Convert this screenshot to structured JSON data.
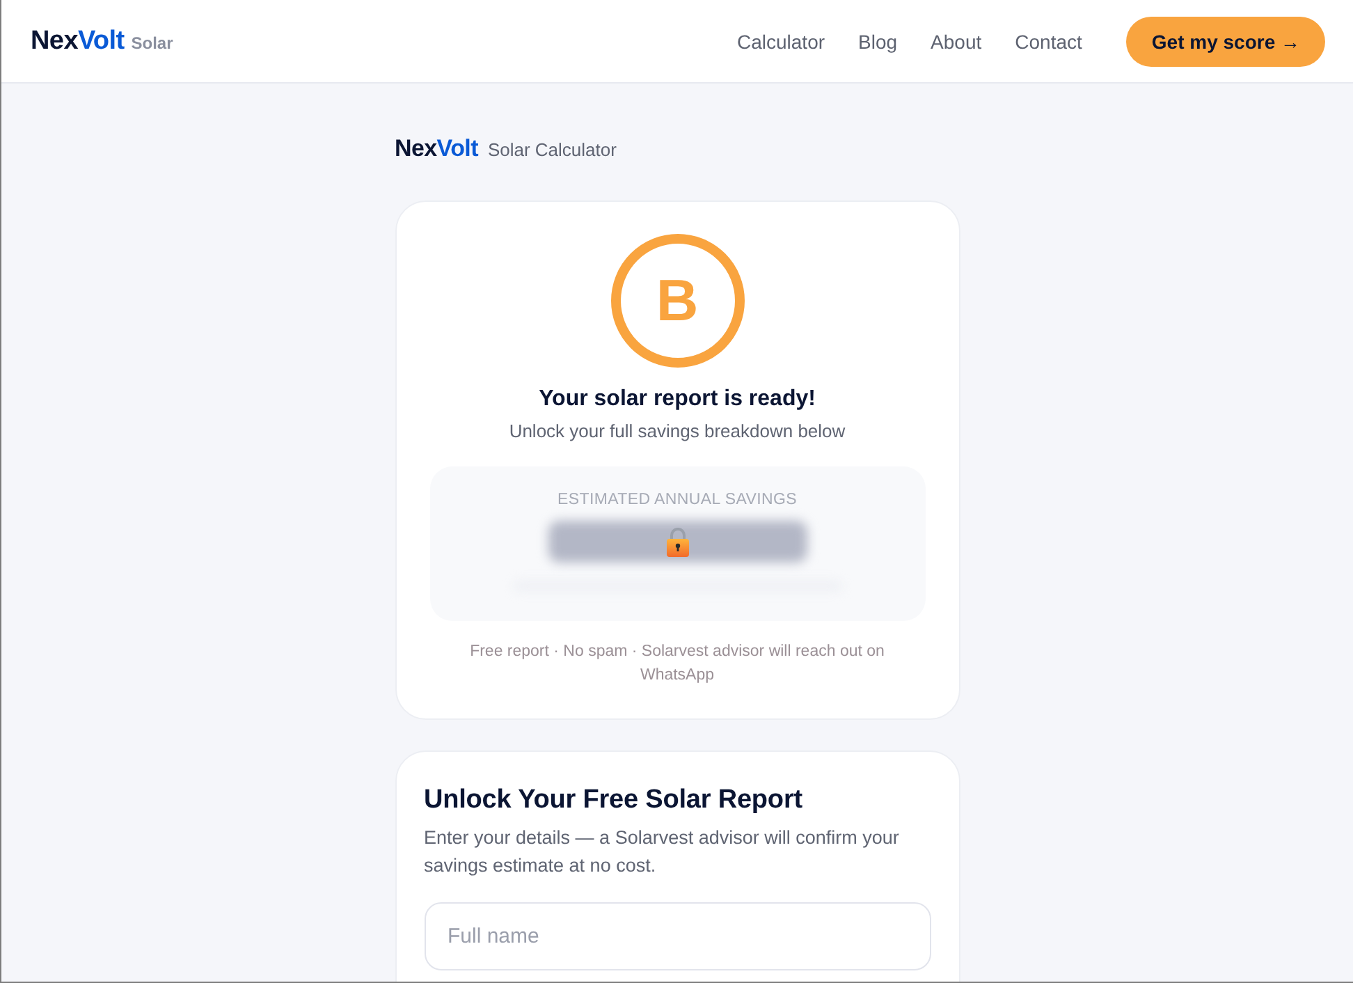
{
  "header": {
    "logo": {
      "part_1": "Nex",
      "part_2": "Volt",
      "suffix": "Solar"
    },
    "nav": [
      {
        "label": "Calculator"
      },
      {
        "label": "Blog"
      },
      {
        "label": "About"
      },
      {
        "label": "Contact"
      }
    ],
    "cta": "Get my score →"
  },
  "brand": {
    "part_1": "Nex",
    "part_2": "Volt",
    "label": "Solar Calculator"
  },
  "result_card": {
    "grade": "B",
    "title": "Your solar report is ready!",
    "subtitle": "Unlock your full savings breakdown below",
    "savings": {
      "label": "ESTIMATED ANNUAL SAVINGS",
      "locked": true
    },
    "note": "Free report · No spam · Solarvest advisor will reach out on WhatsApp"
  },
  "form_card": {
    "title": "Unlock Your Free Solar Report",
    "description": "Enter your details — a Solarvest advisor will confirm your savings estimate at no cost.",
    "fields": [
      {
        "placeholder": "Full name"
      }
    ]
  }
}
